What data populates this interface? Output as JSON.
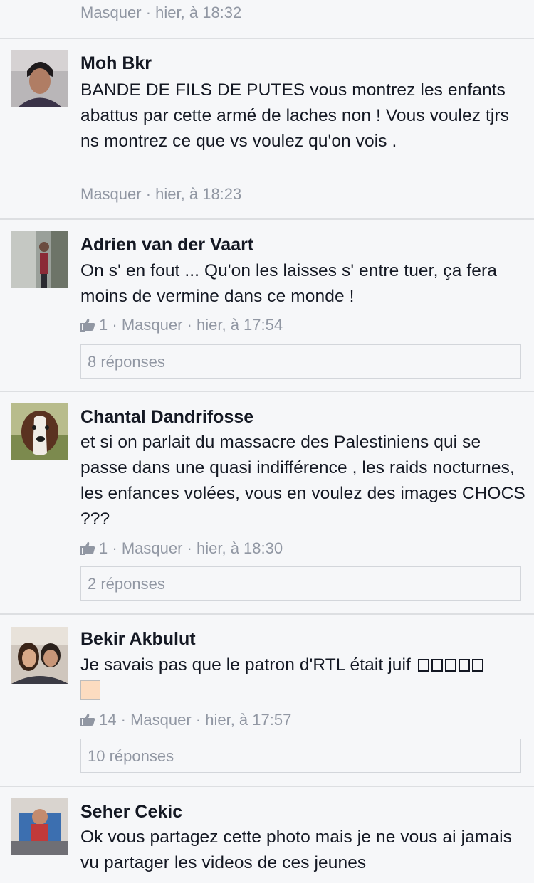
{
  "top_meta": {
    "hide": "Masquer",
    "time": "hier, à 18:32"
  },
  "comments": [
    {
      "author": "Moh Bkr",
      "text": "BANDE DE FILS DE PUTES vous montrez les enfants abattus par cette armé de laches non ! Vous voulez tjrs ns montrez ce que vs voulez qu'on vois .",
      "hide": "Masquer",
      "time": "hier, à 18:23"
    },
    {
      "author": "Adrien van der Vaart",
      "text": "On s' en fout ... Qu'on les laisses s' entre tuer, ça fera moins de vermine dans ce monde !",
      "likes": "1",
      "hide": "Masquer",
      "time": "hier, à 17:54",
      "replies": "8 réponses"
    },
    {
      "author": "Chantal Dandrifosse",
      "text": "et si on parlait du massacre des Palestiniens qui se passe dans une quasi indifférence , les raids nocturnes, les enfances volées, vous en voulez des images CHOCS ???",
      "likes": "1",
      "hide": "Masquer",
      "time": "hier, à 18:30",
      "replies": "2 réponses"
    },
    {
      "author": "Bekir Akbulut",
      "text": "Je savais pas que le patron d'RTL était juif",
      "likes": "14",
      "hide": "Masquer",
      "time": "hier, à 17:57",
      "replies": "10 réponses"
    },
    {
      "author": "Seher Cekic",
      "text": "Ok vous partagez cette photo mais je ne vous ai jamais vu partager les videos de ces jeunes"
    }
  ],
  "separator": "·",
  "colors": {
    "background": "#f6f7f9",
    "meta": "#9197a3",
    "text": "#141823",
    "divider": "#dddfe2"
  },
  "icons": {
    "like": "thumbs-up-icon"
  }
}
